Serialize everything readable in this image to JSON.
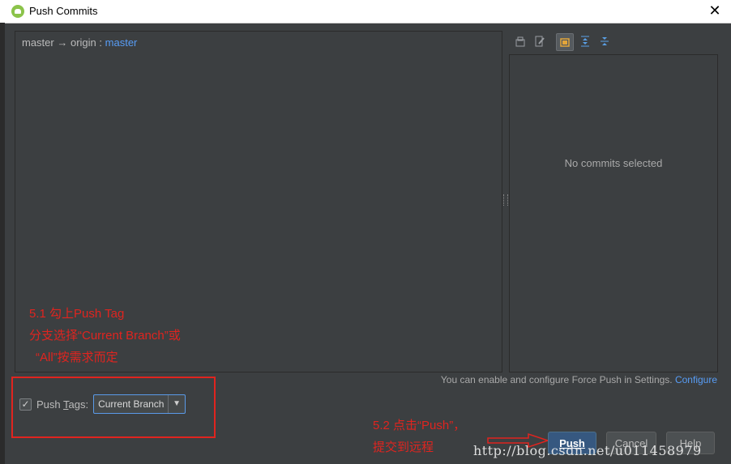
{
  "window": {
    "title": "Push Commits"
  },
  "commits_panel": {
    "local_branch": "master",
    "arrow": "→",
    "remote": "origin",
    "separator": ":",
    "remote_branch": "master"
  },
  "details_panel": {
    "empty_text": "No commits selected"
  },
  "force_push": {
    "text": "You can enable and configure Force Push in Settings.",
    "link": "Configure"
  },
  "push_tags": {
    "label_prefix": "Push ",
    "label_mnemonic": "T",
    "label_suffix": "ags:",
    "checked": true,
    "selected_option": "Current Branch"
  },
  "buttons": {
    "push": "Push",
    "cancel": "Cancel",
    "help": "Help"
  },
  "annotations": {
    "note1_line1": "5.1 勾上Push Tag",
    "note1_line2": "分支选择“Current Branch”或",
    "note1_line3": "“All”按需求而定",
    "note2_line1": "5.2 点击“Push”，",
    "note2_line2": "提交到远程"
  },
  "watermark": "http://blog.csdn.net/u011458979",
  "icons": [
    "android-icon",
    "close-icon",
    "expand-all-icon",
    "collapse-all-icon",
    "group-icon",
    "edit-icon",
    "folder-icon"
  ],
  "colors": {
    "link": "#589df6",
    "annotation": "#e0241f",
    "primary_button": "#365880"
  }
}
